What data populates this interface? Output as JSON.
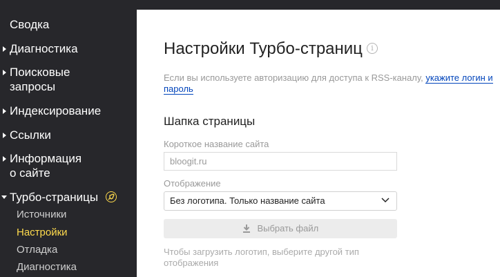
{
  "sidebar": {
    "items": [
      {
        "label": "Сводка"
      },
      {
        "label": "Диагностика"
      },
      {
        "label_line1": "Поисковые",
        "label_line2": "запросы"
      },
      {
        "label": "Индексирование"
      },
      {
        "label": "Ссылки"
      },
      {
        "label_line1": "Информация",
        "label_line2": "о сайте"
      },
      {
        "label": "Турбо-страницы",
        "icon": "turbo-rocket-icon"
      }
    ],
    "subitems": [
      {
        "label": "Источники"
      },
      {
        "label": "Настройки",
        "active": true
      },
      {
        "label": "Отладка"
      },
      {
        "label": "Диагностика"
      }
    ],
    "accent_color": "#ffdb4d"
  },
  "main": {
    "title": "Настройки Турбо-страниц",
    "info_icon": "i",
    "hint_text": "Если вы используете авторизацию для доступа к RSS-каналу,",
    "hint_link": "укажите логин и пароль",
    "section_title": "Шапка страницы",
    "short_name_label": "Короткое название сайта",
    "short_name_value": "bloogit.ru",
    "display_label": "Отображение",
    "display_value": "Без логотипа. Только название сайта",
    "file_button": "Выбрать файл",
    "note": "Чтобы загрузить логотип, выберите другой тип отображения"
  }
}
